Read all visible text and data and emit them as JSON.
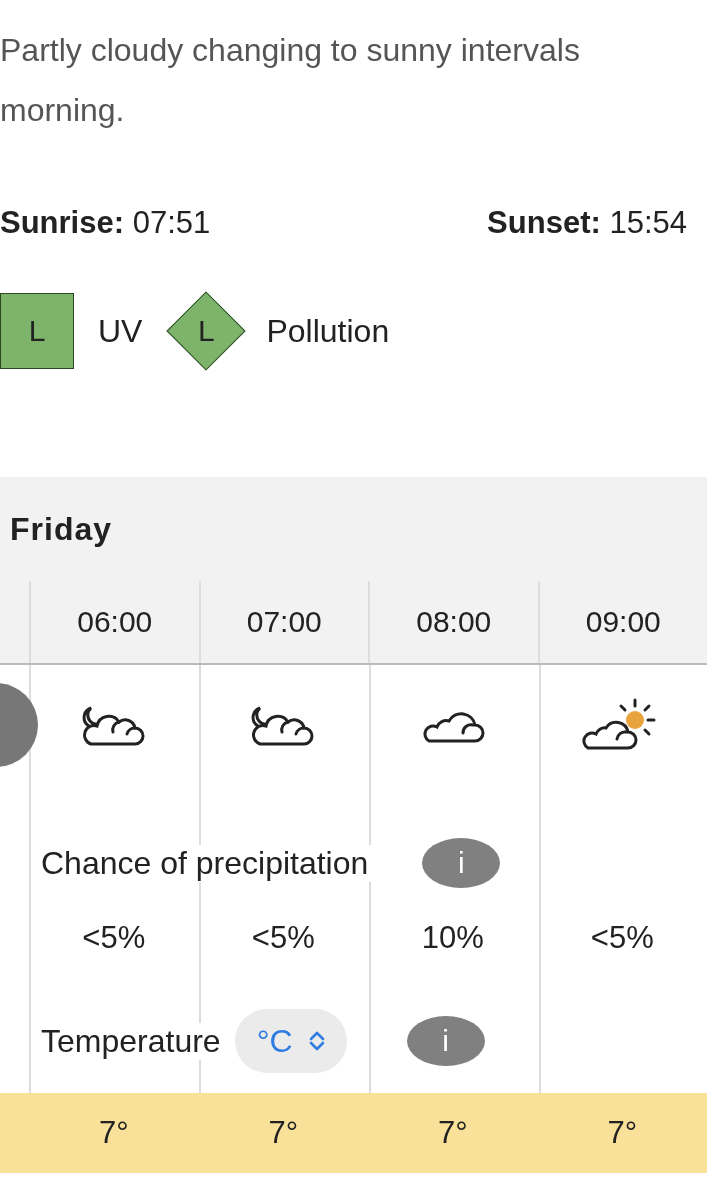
{
  "summary_lines": [
    "Partly cloudy changing to sunny intervals",
    "morning."
  ],
  "sun": [
    {
      "label": "Sunrise:",
      "time": "07:51"
    },
    {
      "label": "Sunset:",
      "time": "15:54"
    }
  ],
  "indices": [
    {
      "kind": "square",
      "level": "L",
      "label": "UV"
    },
    {
      "kind": "diamond",
      "level": "L",
      "label": "Pollution"
    }
  ],
  "day": "Friday",
  "hours": [
    {
      "time": "06:00",
      "kind": "night-cloud",
      "precipitation": "<5%",
      "temperature": "7°"
    },
    {
      "time": "07:00",
      "kind": "night-cloud",
      "precipitation": "<5%",
      "temperature": "7°"
    },
    {
      "time": "08:00",
      "kind": "cloud",
      "precipitation": "10%",
      "temperature": "7°"
    },
    {
      "time": "09:00",
      "kind": "sun-cloud",
      "precipitation": "<5%",
      "temperature": "7°"
    }
  ],
  "precipitation": {
    "label": "Chance of precipitation",
    "info": "i"
  },
  "temperature": {
    "label": "Temperature",
    "unit": "°C",
    "info": "i"
  }
}
